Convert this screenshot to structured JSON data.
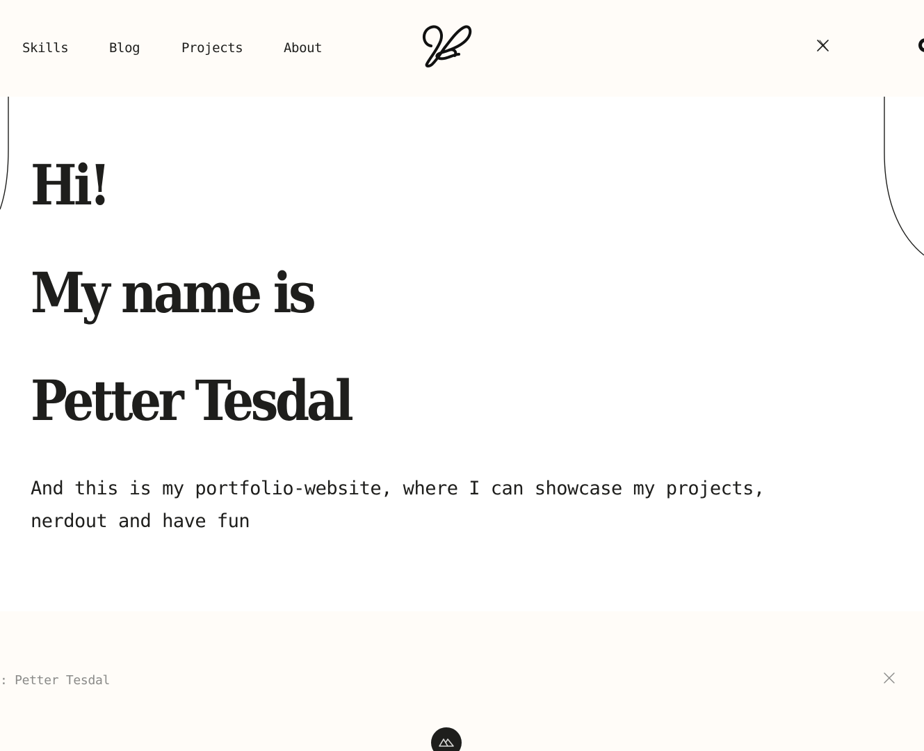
{
  "nav": {
    "items": [
      {
        "label": "Skills"
      },
      {
        "label": "Blog"
      },
      {
        "label": "Projects"
      },
      {
        "label": "About"
      }
    ],
    "logo_icon": "pl-monogram-logo",
    "social_icon": "x-icon"
  },
  "hero": {
    "line1": "Hi!",
    "line2": "My name is",
    "line3": "Petter Tesdal",
    "intro": "And this is my portfolio-website, where I can showcase my projects, nerdout and have fun"
  },
  "footer": {
    "copyright": ": Petter Tesdal",
    "social_icon": "x-icon",
    "badge_icon": "nuxt-icon"
  },
  "colors": {
    "header_bg": "#fffcf8",
    "page_bg": "#ffffff",
    "text": "#1e1e1c",
    "muted_text": "#8a8a88"
  }
}
